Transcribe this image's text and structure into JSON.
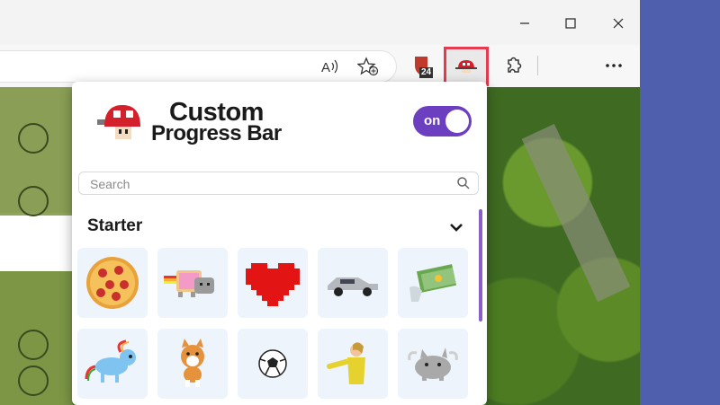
{
  "window": {
    "controls": {
      "minimize": "minimize-icon",
      "maximize": "maximize-icon",
      "close": "close-icon"
    }
  },
  "toolbar": {
    "read_aloud_icon": "read-aloud-icon",
    "favorite_icon": "add-favorite-icon",
    "ext_badge": "24",
    "extensions_icon": "puzzle-icon",
    "more_icon": "more-icon"
  },
  "popup": {
    "title_line1": "Custom",
    "title_line2": "Progress Bar",
    "toggle_label": "on",
    "toggle_on": true,
    "search": {
      "placeholder": "Search",
      "value": ""
    },
    "section": "Starter",
    "tiles": [
      "pizza",
      "nyan-cat",
      "pixel-heart",
      "delorean-car",
      "money-stack",
      "rainbow-pony",
      "corgi",
      "soccer-ball",
      "dancing-person",
      "pusheen-cat"
    ]
  },
  "colors": {
    "accent": "#6c3fc1",
    "highlight": "#e53a4f"
  }
}
